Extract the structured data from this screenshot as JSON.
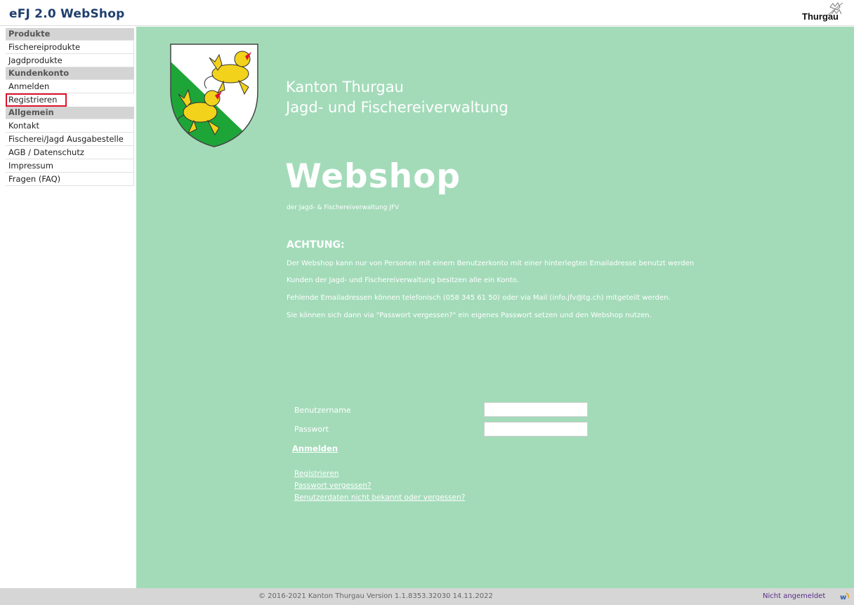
{
  "header": {
    "app_title": "eFJ 2.0 WebShop",
    "brand": "Thurgau"
  },
  "sidebar": {
    "sections": [
      {
        "title": "Produkte",
        "items": [
          "Fischereiprodukte",
          "Jagdprodukte"
        ]
      },
      {
        "title": "Kundenkonto",
        "items": [
          "Anmelden",
          "Registrieren"
        ]
      },
      {
        "title": "Allgemein",
        "items": [
          "Kontakt",
          "Fischerei/Jagd Ausgabestelle",
          "AGB / Datenschutz",
          "Impressum",
          "Fragen (FAQ)"
        ]
      }
    ]
  },
  "main": {
    "kanton_line1": "Kanton Thurgau",
    "kanton_line2": "Jagd- und Fischereiverwaltung",
    "webshop_title": "Webshop",
    "webshop_subtitle": "der Jagd- & Fischereiverwaltung JFV",
    "achtung_title": "ACHTUNG:",
    "notice_lines": [
      "Der Webshop kann nur von Personen mit einem Benutzerkonto mit einer hinterlegten Emailadresse benutzt werden",
      "Kunden der Jagd- und Fischereiverwaltung besitzen alle ein Konto.",
      "Fehlende Emailadressen können telefonisch (058 345 61 50) oder via Mail (info.jfv@tg.ch) mitgeteilt werden.",
      "Sie können sich dann via \"Passwort vergessen?\" ein eigenes Passwort setzen und den Webshop nutzen."
    ],
    "login": {
      "username_label": "Benutzername",
      "password_label": "Passwort",
      "username_value": "",
      "password_value": "",
      "submit_label": "Anmelden",
      "links": [
        "Registrieren",
        "Passwort vergessen?",
        "Benutzerdaten nicht bekannt oder vergessen?"
      ]
    }
  },
  "footer": {
    "copyright": "© 2016-2021 Kanton Thurgau Version 1.1.8353.32030 14.11.2022",
    "login_status": "Nicht angemeldet"
  },
  "colors": {
    "main_bg": "#a3dbb9",
    "title_blue": "#1f3f6e",
    "highlight_red": "#e0142d",
    "coat_green": "#1ea538",
    "coat_yellow": "#f2d21b"
  },
  "icons": [
    "thurgau-lions-icon",
    "coat-of-arms-icon",
    "webdesk-logo-icon"
  ]
}
